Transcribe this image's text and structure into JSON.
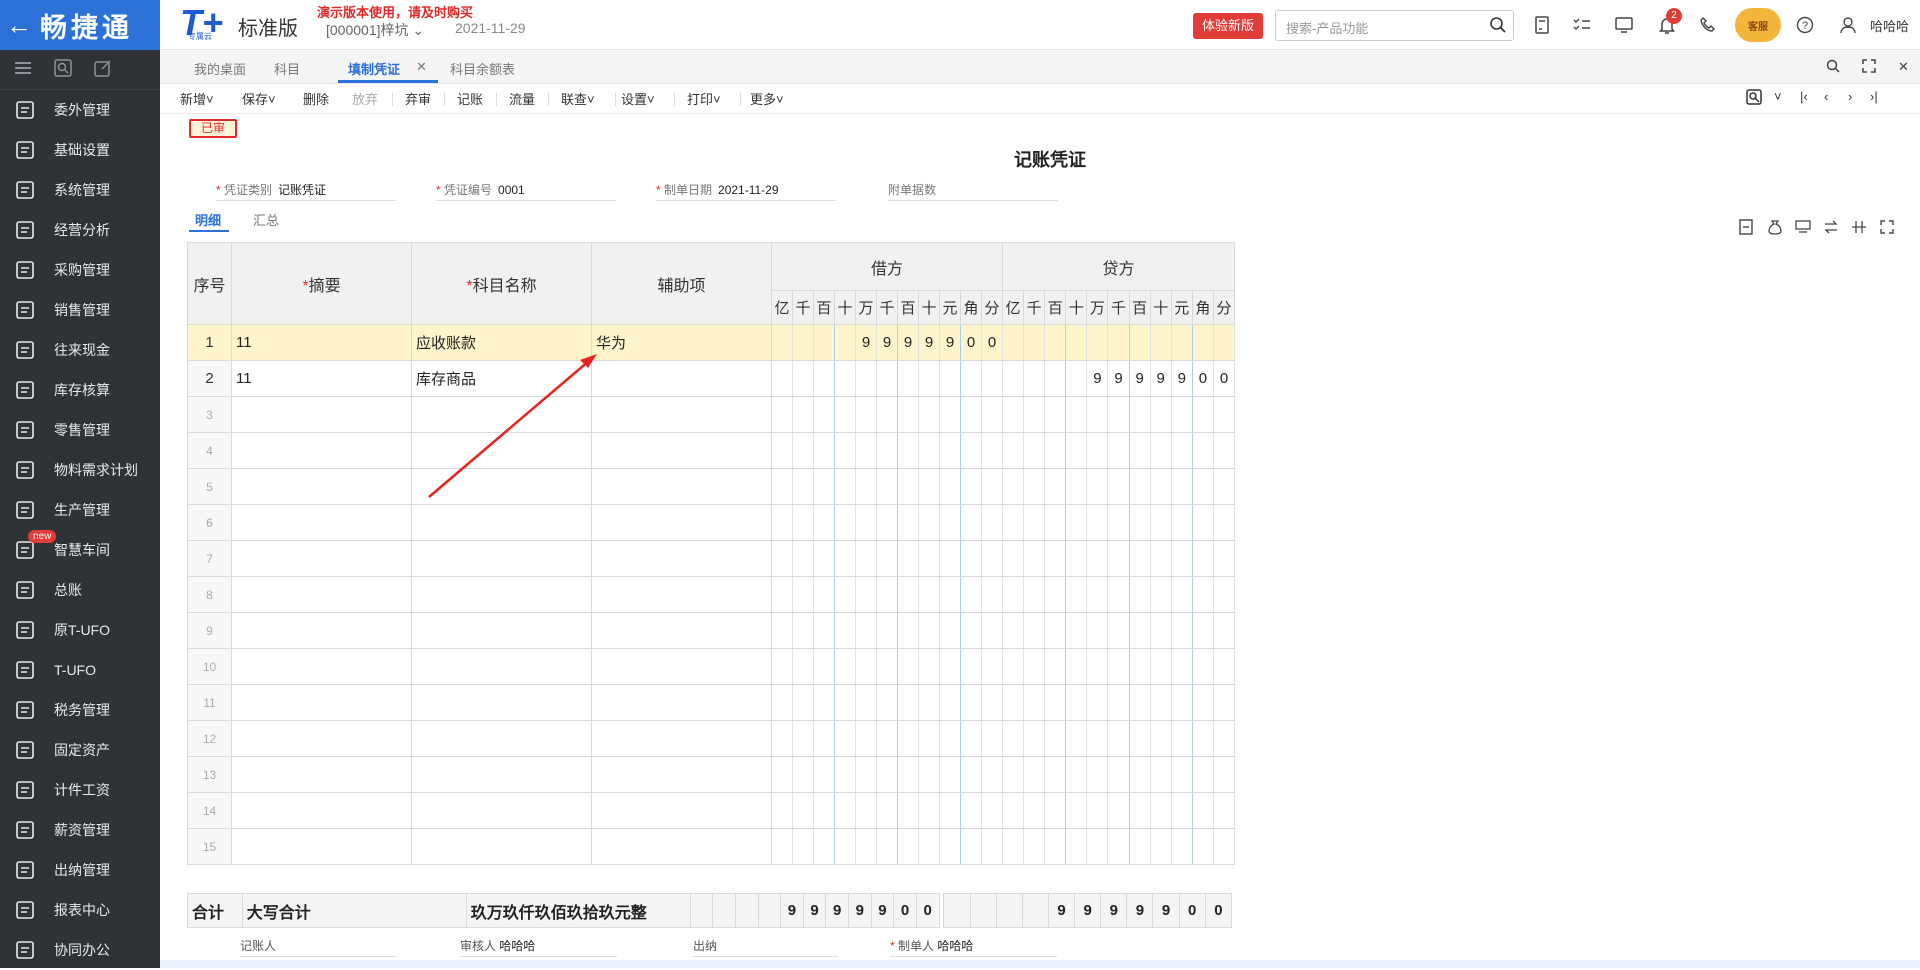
{
  "top": {
    "brand": "畅捷通",
    "back_icon": "arrow-left-icon",
    "logo_text": "T+",
    "logo_sub": "专属云",
    "edition": "标准版",
    "demo_notice": "演示版本使用，请及时购买",
    "account": "[000001]梓坑",
    "date": "2021-11-29",
    "try_new": "体验新版",
    "search_placeholder": "搜索-产品功能",
    "notify_count": "2",
    "bot_label": "客服",
    "user": "哈哈哈",
    "accent": "#2b71d8",
    "danger": "#e23c38"
  },
  "sidebar": {
    "items": [
      {
        "label": "委外管理",
        "icon": "outsource-icon"
      },
      {
        "label": "基础设置",
        "icon": "settings-icon"
      },
      {
        "label": "系统管理",
        "icon": "system-icon"
      },
      {
        "label": "经营分析",
        "icon": "analysis-icon"
      },
      {
        "label": "采购管理",
        "icon": "purchase-icon"
      },
      {
        "label": "销售管理",
        "icon": "sales-icon"
      },
      {
        "label": "往来现金",
        "icon": "cash-icon"
      },
      {
        "label": "库存核算",
        "icon": "inventory-icon"
      },
      {
        "label": "零售管理",
        "icon": "retail-icon"
      },
      {
        "label": "物料需求计划",
        "icon": "mrp-icon"
      },
      {
        "label": "生产管理",
        "icon": "production-icon"
      },
      {
        "label": "智慧车间",
        "icon": "workshop-icon",
        "badge": "new"
      },
      {
        "label": "总账",
        "icon": "ledger-icon"
      },
      {
        "label": "原T-UFO",
        "icon": "ufo-icon"
      },
      {
        "label": "T-UFO",
        "icon": "tufo-icon"
      },
      {
        "label": "税务管理",
        "icon": "tax-icon"
      },
      {
        "label": "固定资产",
        "icon": "assets-icon"
      },
      {
        "label": "计件工资",
        "icon": "piecework-icon"
      },
      {
        "label": "薪资管理",
        "icon": "salary-icon"
      },
      {
        "label": "出纳管理",
        "icon": "cashier-icon"
      },
      {
        "label": "报表中心",
        "icon": "report-icon"
      },
      {
        "label": "协同办公",
        "icon": "collab-icon"
      }
    ]
  },
  "tabs": [
    "我的桌面",
    "科目",
    "填制凭证",
    "科目余额表"
  ],
  "toolbar": [
    "新增",
    "保存",
    "删除",
    "放弃",
    "弃审",
    "记账",
    "流量",
    "联查",
    "设置",
    "打印",
    "更多"
  ],
  "voucher": {
    "status": "已审",
    "title": "记账凭证",
    "fields": {
      "type_label": "凭证类别",
      "type_value": "记账凭证",
      "no_label": "凭证编号",
      "no_value": "0001",
      "date_label": "制单日期",
      "date_value": "2021-11-29",
      "attach_label": "附单据数"
    },
    "subtabs": [
      "明细",
      "汇总"
    ],
    "headers": {
      "seq": "序号",
      "summary": "摘要",
      "account": "科目名称",
      "aux": "辅助项",
      "debit": "借方",
      "credit": "贷方",
      "units": [
        "亿",
        "千",
        "百",
        "十",
        "万",
        "千",
        "百",
        "十",
        "元",
        "角",
        "分"
      ]
    },
    "rows": [
      {
        "seq": "1",
        "summary": "11",
        "account": "应收账款",
        "aux": "华为",
        "debit": [
          "",
          "",
          "",
          "",
          "9",
          "9",
          "9",
          "9",
          "9",
          "0",
          "0"
        ],
        "credit": [
          "",
          "",
          "",
          "",
          "",
          "",
          "",
          "",
          "",
          "",
          ""
        ]
      },
      {
        "seq": "2",
        "summary": "11",
        "account": "库存商品",
        "aux": "",
        "debit": [
          "",
          "",
          "",
          "",
          "",
          "",
          "",
          "",
          "",
          "",
          ""
        ],
        "credit": [
          "",
          "",
          "",
          "",
          "9",
          "9",
          "9",
          "9",
          "9",
          "0",
          "0"
        ]
      },
      {
        "seq": "3"
      },
      {
        "seq": "4"
      },
      {
        "seq": "5"
      },
      {
        "seq": "6"
      },
      {
        "seq": "7"
      },
      {
        "seq": "8"
      },
      {
        "seq": "9"
      },
      {
        "seq": "10"
      },
      {
        "seq": "11"
      },
      {
        "seq": "12"
      },
      {
        "seq": "13"
      },
      {
        "seq": "14"
      },
      {
        "seq": "15"
      }
    ],
    "total": {
      "label": "合计",
      "uppercase_label": "大写合计",
      "uppercase_value": "玖万玖仟玖佰玖拾玖元整",
      "debit": [
        "",
        "",
        "",
        "",
        "9",
        "9",
        "9",
        "9",
        "9",
        "0",
        "0"
      ],
      "credit": [
        "",
        "",
        "",
        "",
        "9",
        "9",
        "9",
        "9",
        "9",
        "0",
        "0"
      ]
    },
    "footer": {
      "bookkeeper_label": "记账人",
      "bookkeeper": "",
      "reviewer_label": "审核人",
      "reviewer": "哈哈哈",
      "cashier_label": "出纳",
      "cashier": "",
      "maker_label": "制单人",
      "maker": "哈哈哈"
    }
  }
}
